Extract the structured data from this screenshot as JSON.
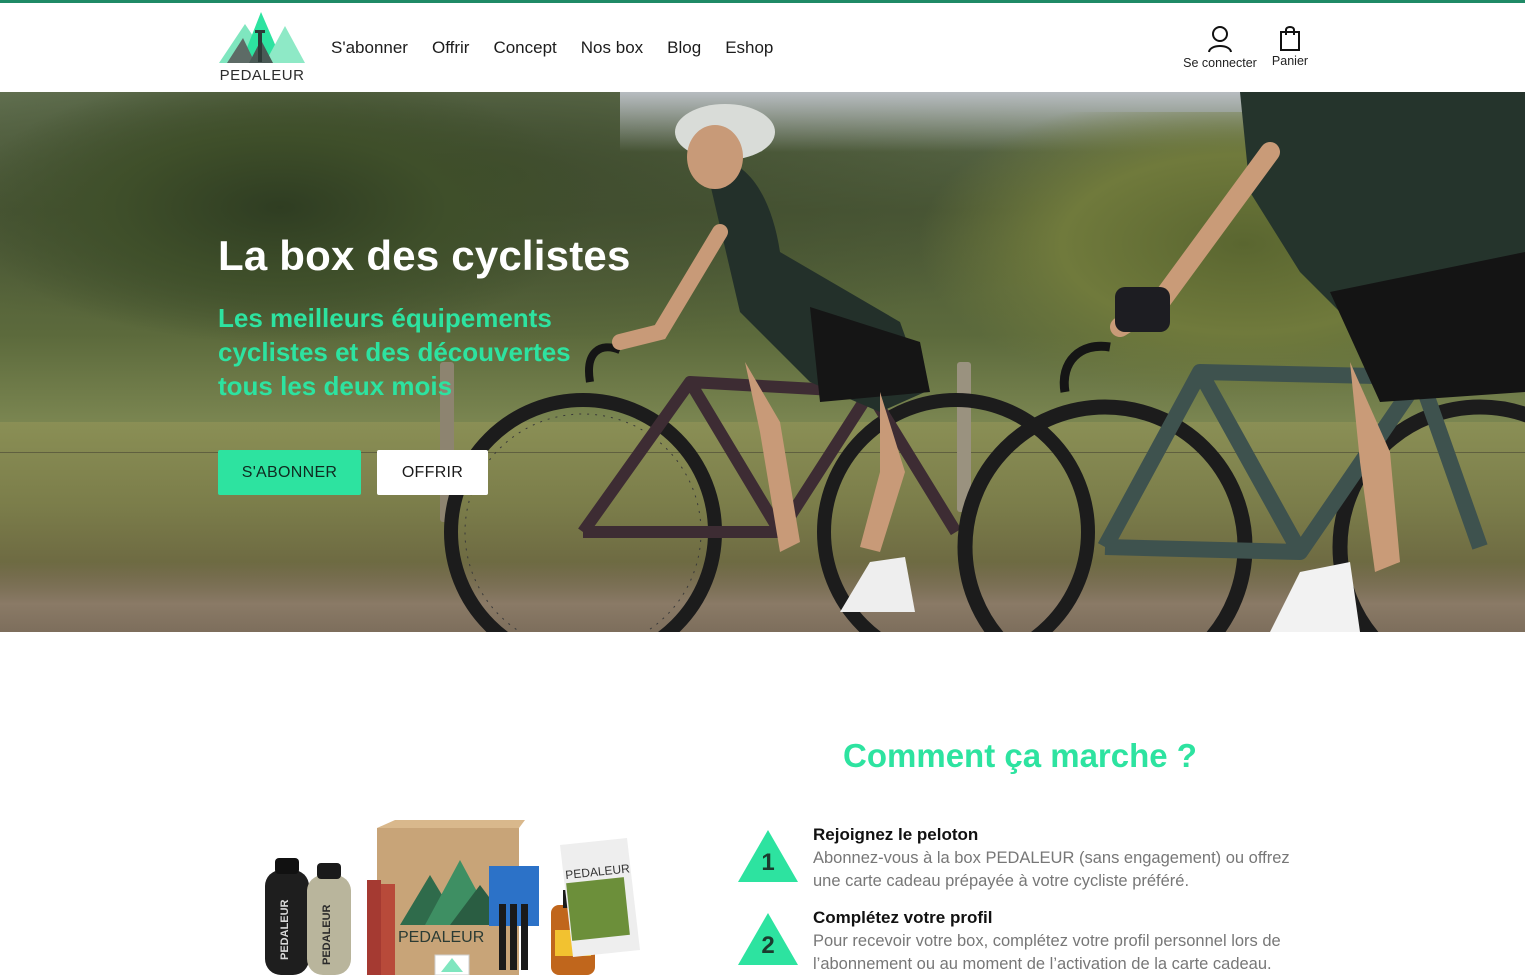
{
  "brand": {
    "name": "PEDALEUR",
    "colors": {
      "accent": "#2de3a0",
      "topline": "#1f8a66",
      "dark_green": "#1b3b2e"
    }
  },
  "nav": {
    "items": [
      {
        "label": "S'abonner"
      },
      {
        "label": "Offrir"
      },
      {
        "label": "Concept"
      },
      {
        "label": "Nos box"
      },
      {
        "label": "Blog"
      },
      {
        "label": "Eshop"
      }
    ]
  },
  "utility": {
    "account_label": "Se connecter",
    "account_icon": "user-icon",
    "cart_label": "Panier",
    "cart_icon": "shopping-bag-icon"
  },
  "hero": {
    "title": "La box des cyclistes",
    "subtitle": "Les meilleurs équipements cyclistes et des découvertes tous les deux mois",
    "primary_button": "S'ABONNER",
    "secondary_button": "OFFRIR"
  },
  "how": {
    "title": "Comment ça marche ?",
    "steps": [
      {
        "number": "1",
        "title": "Rejoignez le peloton",
        "description": "Abonnez-vous à la box PEDALEUR (sans engagement) ou offrez une carte cadeau prépayée à votre cycliste préféré."
      },
      {
        "number": "2",
        "title": "Complétez votre profil",
        "description": "Pour recevoir votre box, complétez votre profil personnel lors de l’abonnement ou au moment de l’activation de la carte cadeau."
      }
    ]
  },
  "product": {
    "bottle_label": "PEDALEUR",
    "box_label": "PEDALEUR",
    "magazine_label": "PEDALEUR"
  }
}
